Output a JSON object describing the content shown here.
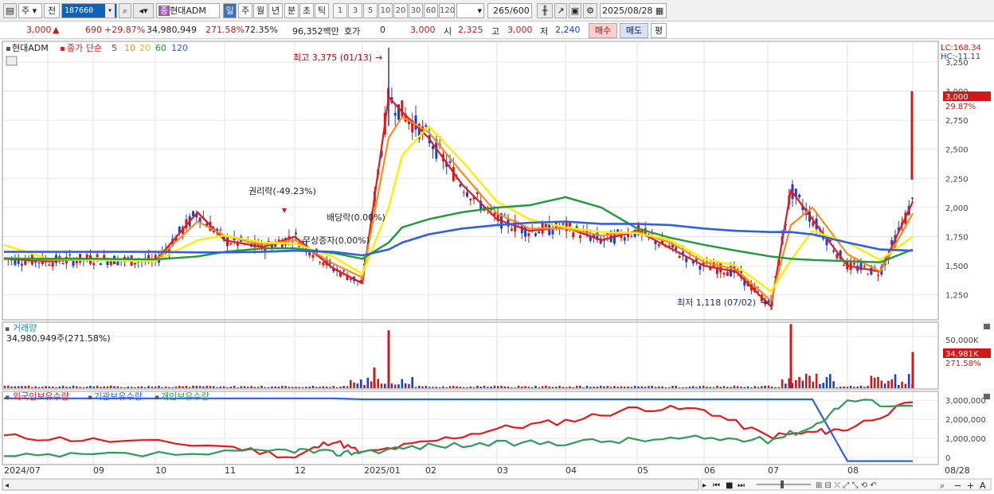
{
  "toolbar": {
    "period_type": "주",
    "prefix": "전",
    "code": "187660",
    "search_icon": "search-icon",
    "name_badge": "종",
    "stock_name": "현대ADM",
    "periods": [
      "일",
      "주",
      "월",
      "년",
      "분",
      "초",
      "틱"
    ],
    "active_period": "일",
    "minute_options": [
      "1",
      "3",
      "5",
      "10",
      "20",
      "30",
      "60",
      "120"
    ],
    "count_value": "265",
    "count_total": "/600",
    "date": "2025/08/28"
  },
  "quote": {
    "price": "3,000",
    "arrow": "▲",
    "change": "690",
    "change_pct": "+29.87%",
    "volume": "34,980,949",
    "volume_ratio": "271.58%",
    "turnover": "72.35%",
    "amount": "96,352백만",
    "ask_label": "호가",
    "ask_value": "0",
    "price2": "3,000",
    "open_label": "시",
    "open_value": "2,325",
    "high_label": "고",
    "high_value": "3,000",
    "low_label": "저",
    "low_value": "2,240",
    "buy_label": "매수",
    "sell_label": "매도",
    "eval_label": "평"
  },
  "colors": {
    "up": "#d01818",
    "down": "#1d3fcf",
    "ma5": "#e41a1c",
    "ma10": "#ff8c1a",
    "ma20": "#ffee00",
    "ma60": "#1f9a3a",
    "ma120": "#3060e0",
    "foreign": "#e41a1c",
    "institution": "#3060e0",
    "individual": "#2f9a5a"
  },
  "price_panel": {
    "legend_name": "현대ADM",
    "legend_type": "종가 단순",
    "legend_periods": [
      "5",
      "10",
      "20",
      "60",
      "120"
    ],
    "lc_label": "LC:168.34",
    "hc_label": "HC:-11.11",
    "annot_high": "최고 3,375 (01/13)",
    "annot_low": "최저 1,118 (07/02)",
    "annot_rights": "권리락(-49.23%)",
    "annot_dividend": "배당락(0.00%)",
    "annot_bonus": "무상증자(0.00%)",
    "current_price": "3,000",
    "current_pct": "29.87%",
    "y_ticks": [
      "3,250",
      "3,000",
      "2,750",
      "2,500",
      "2,250",
      "2,000",
      "1,750",
      "1,500",
      "1,250"
    ]
  },
  "volume_panel": {
    "title": "거래량",
    "value": "34,980,949주(271.58%)",
    "tick": "50,000K",
    "current": "34,981K",
    "current_pct": "271.58%"
  },
  "holdings_panel": {
    "foreign_label": "외국인보유수량",
    "institution_label": "기관보유수량",
    "individual_label": "개인보유수량",
    "y_ticks": [
      "3,000,000",
      "2,000,000",
      "1,000,000",
      "0"
    ]
  },
  "x_axis": [
    "2024/07",
    "09",
    "10",
    "11",
    "12",
    "2025/01",
    "02",
    "03",
    "04",
    "05",
    "06",
    "07",
    "08",
    "08/28"
  ],
  "chart_data": [
    {
      "type": "line",
      "title": "현대ADM 종가 단순",
      "ylim": [
        1050,
        3400
      ],
      "x_dates": [
        "2024/07",
        "2024/08",
        "2024/09",
        "2024/10",
        "2024/10/20",
        "2024/11",
        "2024/11/20",
        "2024/12",
        "2024/12/20",
        "2025/01/01",
        "2025/01/13",
        "2025/01/20",
        "2025/02",
        "2025/02/15",
        "2025/03",
        "2025/03/15",
        "2025/04",
        "2025/04/15",
        "2025/05",
        "2025/05/15",
        "2025/06",
        "2025/06/15",
        "2025/07/02",
        "2025/07/08",
        "2025/07/20",
        "2025/08",
        "2025/08/15",
        "2025/08/28"
      ],
      "series": [
        {
          "name": "5",
          "values": [
            1560,
            1540,
            1560,
            1540,
            1960,
            1720,
            1660,
            1750,
            1480,
            1350,
            2950,
            2820,
            2600,
            2200,
            1900,
            1800,
            1830,
            1720,
            1800,
            1650,
            1500,
            1450,
            1150,
            2150,
            1900,
            1500,
            1450,
            2050
          ]
        },
        {
          "name": "10",
          "values": [
            1570,
            1550,
            1550,
            1540,
            1880,
            1760,
            1680,
            1720,
            1520,
            1400,
            2600,
            2780,
            2650,
            2300,
            1950,
            1820,
            1820,
            1760,
            1790,
            1700,
            1530,
            1470,
            1200,
            1850,
            2000,
            1600,
            1450,
            1950
          ]
        },
        {
          "name": "20",
          "values": [
            1680,
            1560,
            1550,
            1540,
            1720,
            1760,
            1700,
            1690,
            1580,
            1430,
            2000,
            2450,
            2700,
            2400,
            2050,
            1900,
            1830,
            1790,
            1780,
            1720,
            1560,
            1500,
            1280,
            1550,
            1800,
            1700,
            1550,
            1750
          ]
        },
        {
          "name": "60",
          "values": [
            1560,
            1560,
            1560,
            1555,
            1580,
            1620,
            1650,
            1650,
            1610,
            1560,
            1700,
            1830,
            1900,
            1960,
            2000,
            2020,
            2090,
            2000,
            1820,
            1740,
            1680,
            1630,
            1580,
            1560,
            1550,
            1540,
            1530,
            1640
          ]
        },
        {
          "name": "120",
          "values": [
            1620,
            1620,
            1620,
            1620,
            1615,
            1615,
            1620,
            1630,
            1620,
            1590,
            1640,
            1700,
            1770,
            1820,
            1850,
            1870,
            1880,
            1860,
            1860,
            1850,
            1820,
            1800,
            1790,
            1790,
            1770,
            1700,
            1640,
            1630
          ]
        }
      ]
    },
    {
      "type": "bar",
      "title": "거래량",
      "ylim": [
        0,
        60000
      ],
      "unit": "K",
      "peaks": [
        {
          "x": "2025/01/08",
          "value": 20000
        },
        {
          "x": "2025/01/13",
          "value": 56000
        },
        {
          "x": "2025/07/08",
          "value": 62000
        },
        {
          "x": "2025/08/28",
          "value": 34981
        }
      ]
    },
    {
      "type": "line",
      "title": "보유수량",
      "ylim": [
        -300000,
        3300000
      ],
      "x_dates": [
        "2024/07",
        "2024/09",
        "2024/11",
        "2024/12",
        "2024/12/20",
        "2025/01",
        "2025/02",
        "2025/03",
        "2025/04",
        "2025/05",
        "2025/06",
        "2025/07",
        "2025/07/20",
        "2025/08",
        "2025/08/28"
      ],
      "series": [
        {
          "name": "외국인보유수량",
          "values": [
            1100000,
            900000,
            600000,
            0,
            900000,
            200000,
            800000,
            1500000,
            1900000,
            2600000,
            2500000,
            1100000,
            1300000,
            1500000,
            2900000
          ]
        },
        {
          "name": "기관보유수량",
          "values": [
            3100000,
            3100000,
            3100000,
            3100000,
            3100000,
            3050000,
            3050000,
            3050000,
            3050000,
            3050000,
            3050000,
            3050000,
            3050000,
            -200000,
            -200000
          ]
        },
        {
          "name": "개인보유수량",
          "values": [
            0,
            100000,
            200000,
            400000,
            200000,
            300000,
            600000,
            700000,
            800000,
            900000,
            1000000,
            900000,
            1600000,
            3000000,
            2700000
          ]
        }
      ]
    }
  ]
}
